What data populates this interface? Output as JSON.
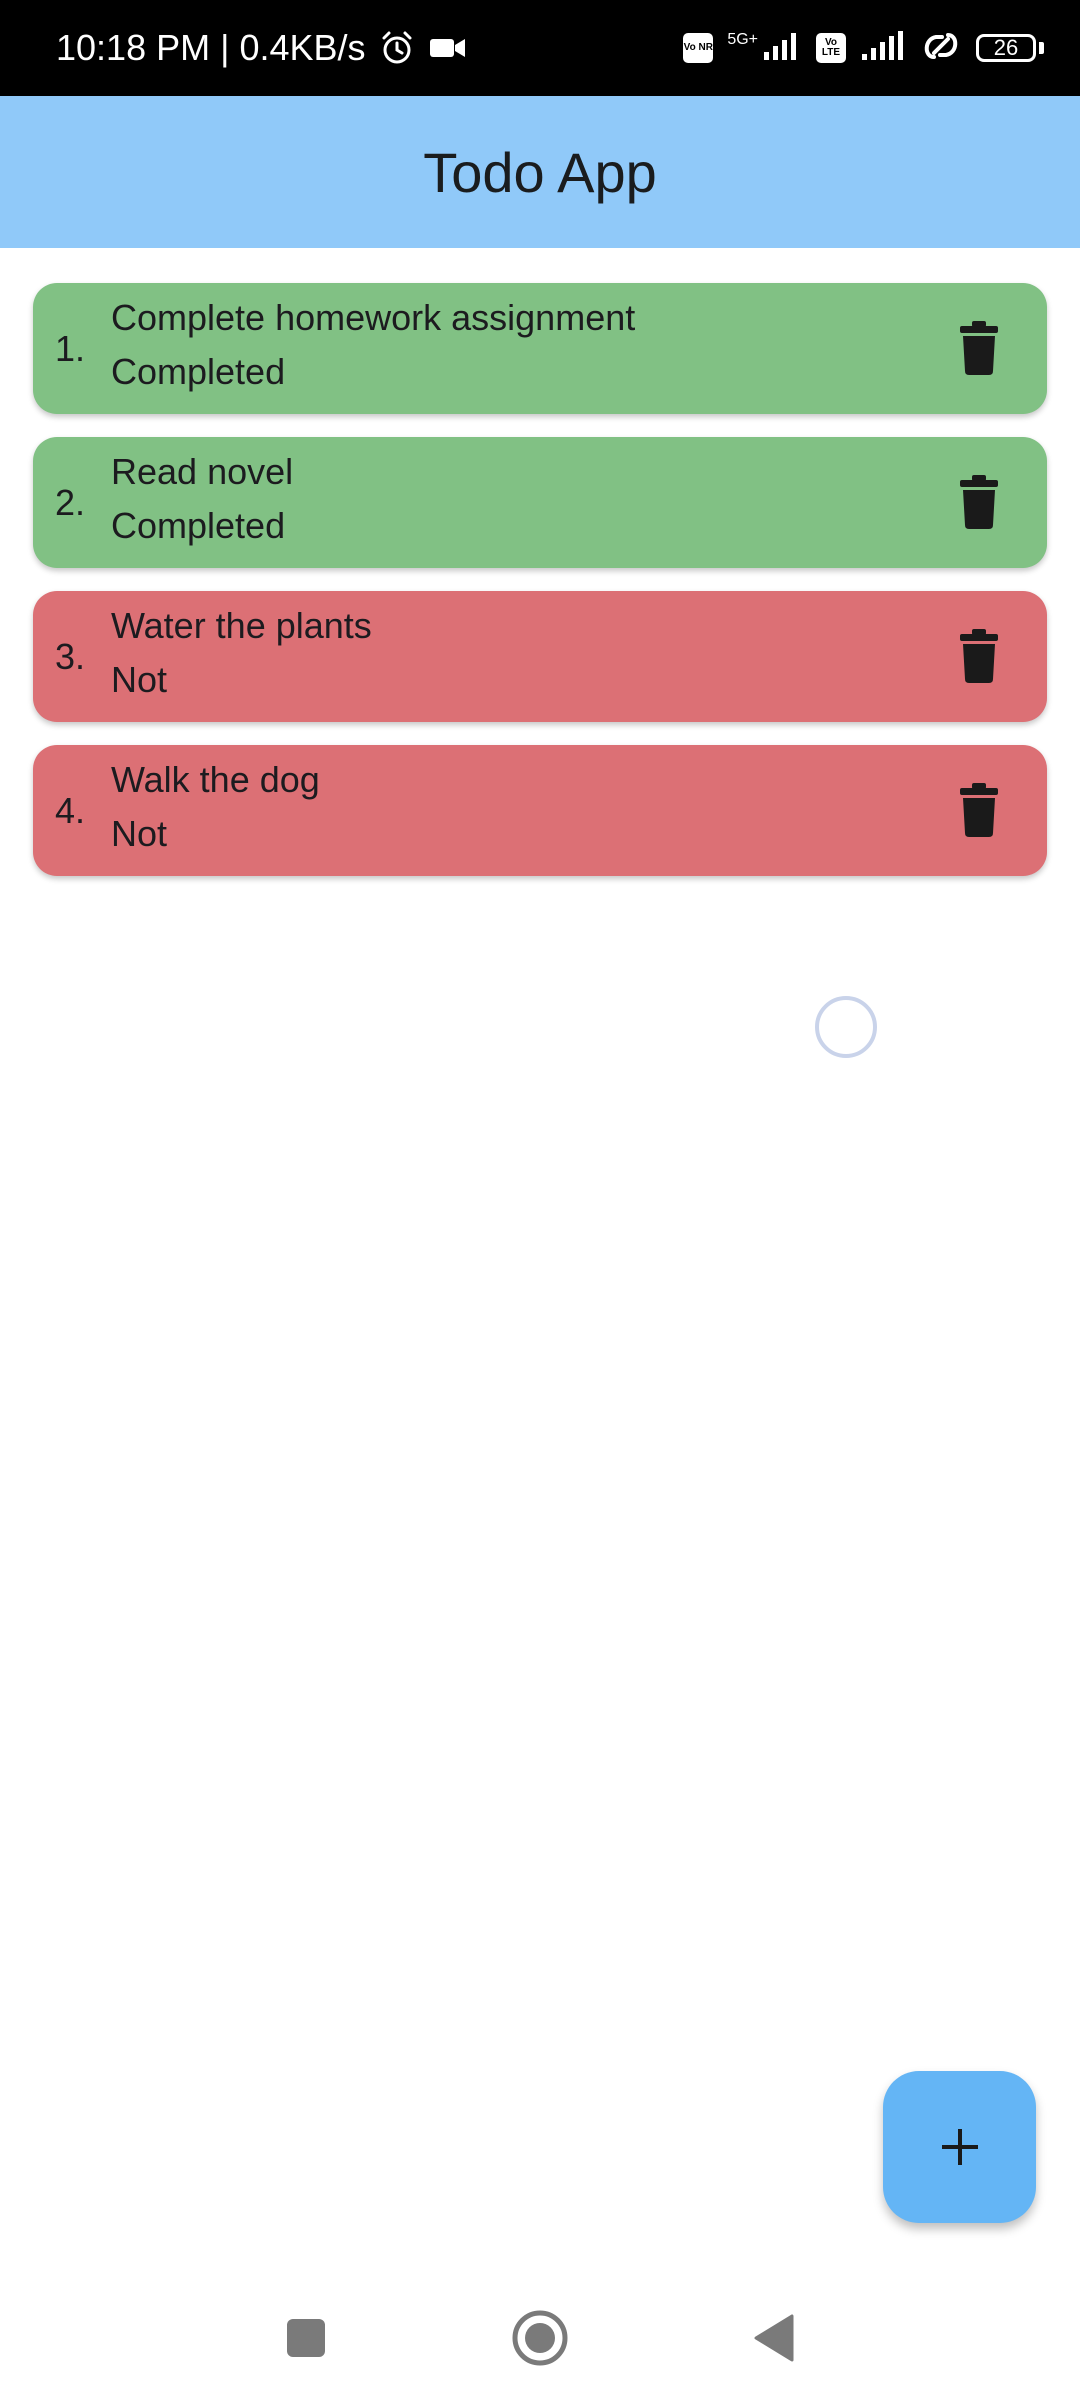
{
  "status_bar": {
    "time_speed": "10:18 PM | 0.4KB/s",
    "sim1_badge": "Vo NR",
    "sim1_network": "5G+",
    "sim2_badge": "Vo LTE",
    "battery": "26"
  },
  "app_bar": {
    "title": "Todo App"
  },
  "todos": [
    {
      "index": "1.",
      "title": "Complete homework assignment",
      "status": "Completed",
      "done": true
    },
    {
      "index": "2.",
      "title": "Read novel",
      "status": "Completed",
      "done": true
    },
    {
      "index": "3.",
      "title": "Water the plants",
      "status": "Not",
      "done": false
    },
    {
      "index": "4.",
      "title": "Walk the dog",
      "status": "Not",
      "done": false
    }
  ],
  "icons": {
    "delete": "trash-icon",
    "add": "plus-icon",
    "alarm": "alarm-icon",
    "video": "video-camera-icon",
    "hotspot": "link-icon",
    "nav_recents": "square-icon",
    "nav_home": "circle-icon",
    "nav_back": "triangle-back-icon"
  },
  "colors": {
    "app_bar": "#90c9f9",
    "completed": "#81c184",
    "not_completed": "#dc7075",
    "fab": "#64b5f5"
  }
}
